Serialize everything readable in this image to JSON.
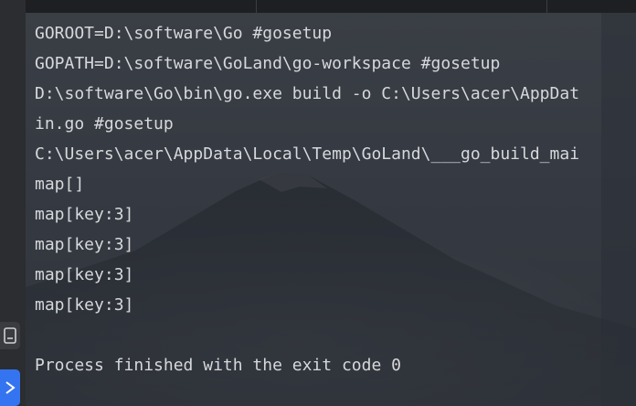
{
  "left_toolbar": {
    "terminal_icon": "terminal-icon",
    "run_icon": "run-icon",
    "accent": "#3574f0"
  },
  "console": {
    "lines": [
      "GOROOT=D:\\software\\Go #gosetup",
      "GOPATH=D:\\software\\GoLand\\go-workspace #gosetup",
      "D:\\software\\Go\\bin\\go.exe build -o C:\\Users\\acer\\AppDat",
      "in.go #gosetup",
      "C:\\Users\\acer\\AppData\\Local\\Temp\\GoLand\\___go_build_mai",
      "map[]",
      "map[key:3]",
      "map[key:3]",
      "map[key:3]",
      "map[key:3]",
      "",
      "Process finished with the exit code 0"
    ],
    "text_color": "#d6d8dc",
    "background_color": "#353941"
  }
}
